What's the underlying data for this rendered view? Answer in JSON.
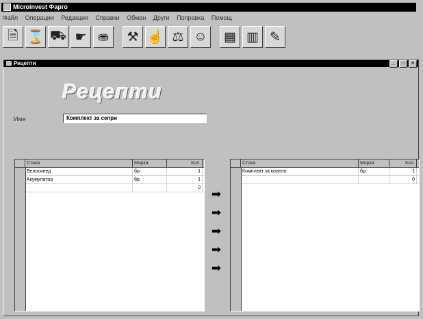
{
  "app": {
    "title": "Microinvest Фарго"
  },
  "menu": {
    "items": [
      "Файл",
      "Операции",
      "Редакция",
      "Справки",
      "Обмен",
      "Други",
      "Поправка",
      "Помощ"
    ]
  },
  "toolbar": {
    "buttons": [
      {
        "name": "document-icon",
        "glyph": "🗎"
      },
      {
        "name": "sales-icon",
        "glyph": "⌛"
      },
      {
        "name": "delivery-icon",
        "glyph": "⛟"
      },
      {
        "name": "hand-icon",
        "glyph": "☛"
      },
      {
        "name": "waste-icon",
        "glyph": "⛂"
      },
      {
        "name": "production-icon",
        "glyph": "⚒"
      },
      {
        "name": "transfer-icon",
        "glyph": "☝"
      },
      {
        "name": "inventory-icon",
        "glyph": "⚖"
      },
      {
        "name": "users-icon",
        "glyph": "☺"
      },
      {
        "name": "calculator-icon",
        "glyph": "▦"
      },
      {
        "name": "book-icon",
        "glyph": "▥"
      },
      {
        "name": "report-icon",
        "glyph": "✎"
      }
    ]
  },
  "window": {
    "title": "Рецепти",
    "minimize": "_",
    "maximize": "□",
    "close": "×"
  },
  "form": {
    "heading": "Рецепти",
    "name_label": "Име",
    "name_value": "Комплект за сепри"
  },
  "left_grid": {
    "headers": {
      "stock": "Стока",
      "mark": "Мярка",
      "qty": "Кол."
    },
    "rows": [
      {
        "marker": "",
        "stock": "Велосипед",
        "mark": "бр.",
        "qty": "1"
      },
      {
        "marker": "✎",
        "stock": "Акумулатор",
        "mark": "бр.",
        "qty": "1"
      },
      {
        "marker": "",
        "stock": "",
        "mark": "",
        "qty": "0"
      }
    ]
  },
  "right_grid": {
    "headers": {
      "stock": "Стока",
      "mark": "Мярка",
      "qty": "Кол."
    },
    "rows": [
      {
        "marker": "✎",
        "stock": "Комплект за колело",
        "mark": "бр.",
        "qty": "1"
      },
      {
        "marker": "",
        "stock": "",
        "mark": "",
        "qty": "0"
      }
    ]
  },
  "transfer_arrows": [
    "➡",
    "➡",
    "➡",
    "➡",
    "➡"
  ]
}
